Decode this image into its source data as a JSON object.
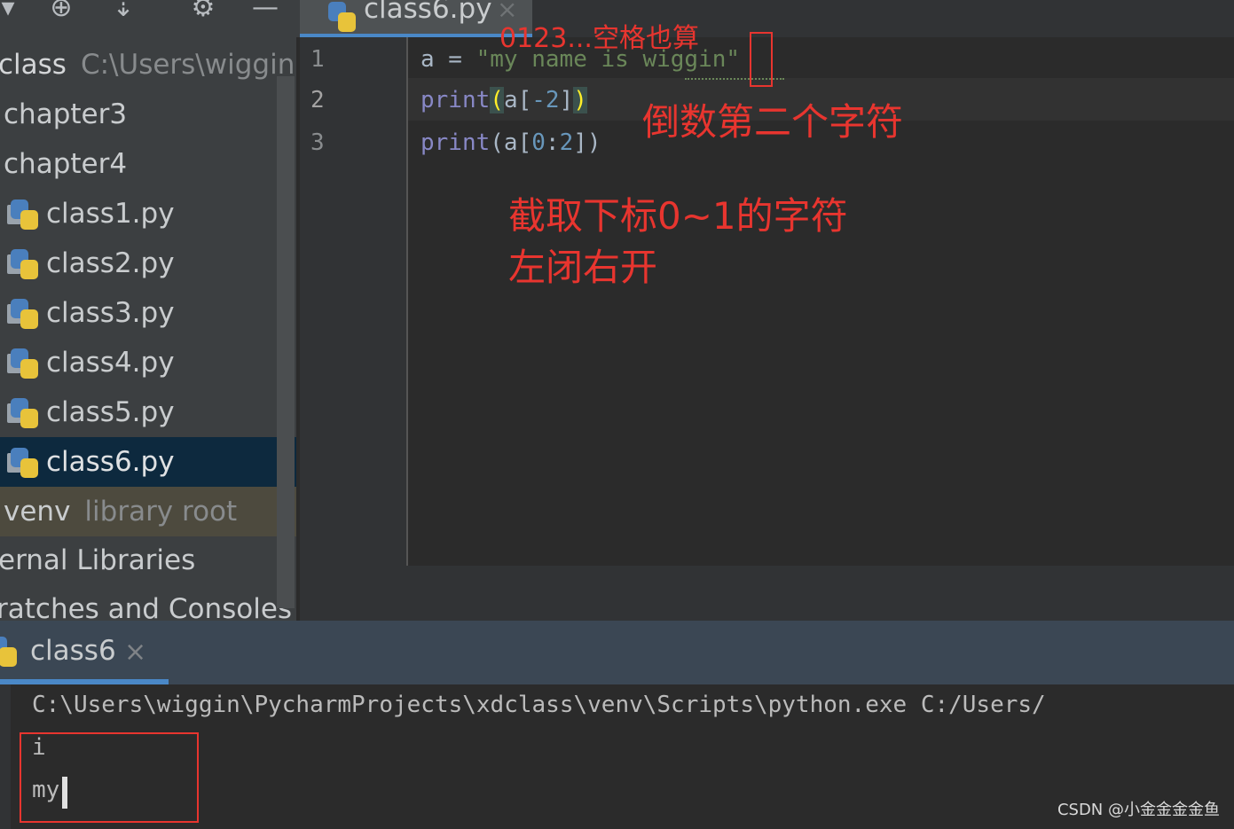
{
  "toolbar": {
    "icons": [
      "collapse-icon",
      "locate-icon",
      "scroll-from-source-icon",
      "settings-icon",
      "minimize-icon"
    ]
  },
  "editor_tab": {
    "label": "class6.py",
    "close": "×"
  },
  "project": {
    "root": {
      "name": "class",
      "path": "C:\\Users\\wiggin"
    },
    "items": [
      {
        "label": "chapter3"
      },
      {
        "label": "chapter4"
      },
      {
        "label": "class1.py"
      },
      {
        "label": "class2.py"
      },
      {
        "label": "class3.py"
      },
      {
        "label": "class4.py"
      },
      {
        "label": "class5.py"
      },
      {
        "label": "class6.py"
      },
      {
        "label": "venv",
        "hint": "library root"
      },
      {
        "label": "ernal Libraries"
      },
      {
        "label": "ratches and Consoles"
      }
    ]
  },
  "editor": {
    "line_numbers": [
      "1",
      "2",
      "3"
    ],
    "lines": [
      {
        "a": "a",
        "eq": " = ",
        "str": "\"my name is wiggin\""
      },
      {
        "fn": "print",
        "open": "(",
        "arg": "a[",
        "num": "-2",
        "close_b": "]",
        "close": ")"
      },
      {
        "fn": "print",
        "open": "(a[",
        "num1": "0",
        "colon": ":",
        "num2": "2",
        "close": "])"
      }
    ]
  },
  "annotations": {
    "index_note": "0123...空格也算",
    "line2_note": "倒数第二个字符",
    "line3_note_1": "截取下标0~1的字符",
    "line3_note_2": "左闭右开"
  },
  "run_panel": {
    "tab_label": "class6",
    "close": "×",
    "command": "C:\\Users\\wiggin\\PycharmProjects\\xdclass\\venv\\Scripts\\python.exe C:/Users/",
    "output": [
      "i",
      "my"
    ]
  },
  "watermark": "CSDN @小金金金金鱼"
}
